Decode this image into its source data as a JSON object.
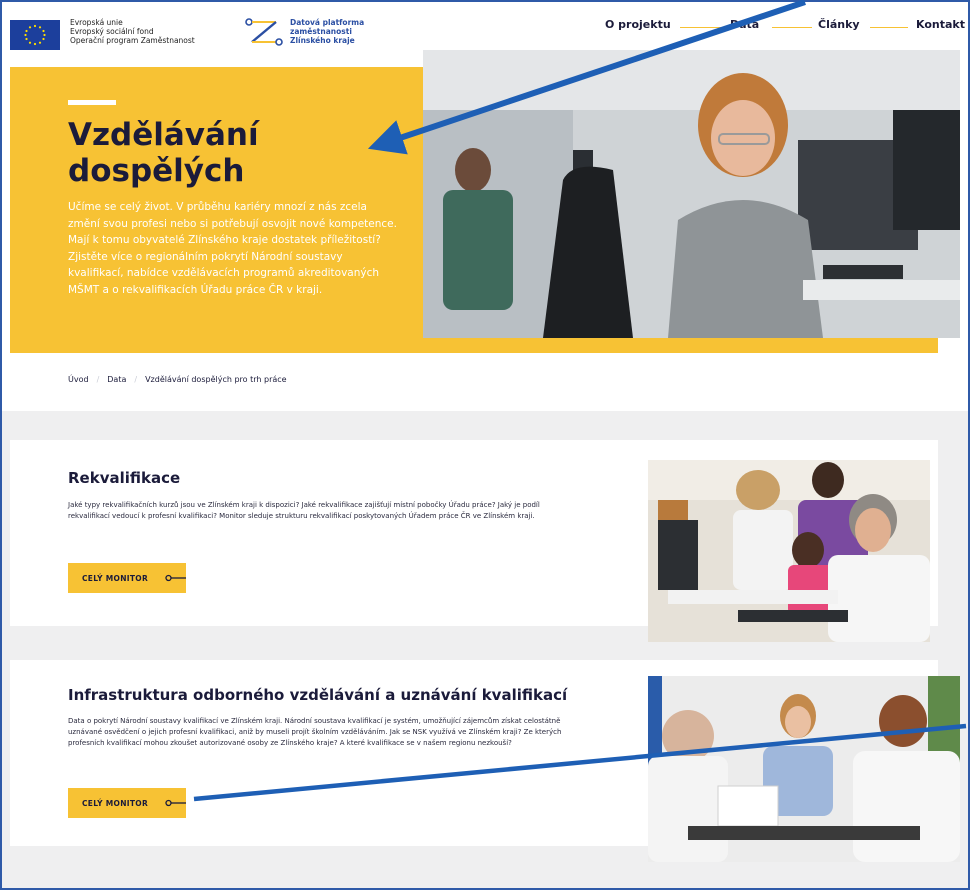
{
  "header": {
    "eu_lines": [
      "Evropská unie",
      "Evropský sociální fond",
      "Operační program Zaměstnanost"
    ],
    "platform_lines": [
      "Datová platforma",
      "zaměstnanosti",
      "Zlínského kraje"
    ],
    "nav": [
      {
        "label": "O projektu"
      },
      {
        "label": "Data"
      },
      {
        "label": "Články"
      },
      {
        "label": "Kontakt"
      }
    ]
  },
  "hero": {
    "title_line1": "Vzdělávání",
    "title_line2": "dospělých",
    "text": "Učíme se celý život. V průběhu kariéry mnozí z nás zcela změní svou profesi nebo si potřebují osvojit nové kompetence. Mají k tomu obyvatelé Zlínského kraje dostatek příležitostí? Zjistěte více o regionálním pokrytí Národní soustavy kvalifikací, nabídce vzdělávacích programů akreditovaných MŠMT a o rekvalifikacích Úřadu práce ČR v kraji."
  },
  "breadcrumb": [
    "Úvod",
    "Data",
    "Vzdělávání dospělých pro trh práce"
  ],
  "cards": [
    {
      "title": "Rekvalifikace",
      "text": "Jaké typy rekvalifikačních kurzů jsou ve Zlínském kraji k dispozici? Jaké rekvalifikace zajišťují místní pobočky Úřadu práce? Jaký je podíl rekvalifikací vedoucí k profesní kvalifikaci? Monitor sleduje strukturu rekvalifikací poskytovaných Úřadem práce ČR ve Zlínském kraji.",
      "cta": "CELÝ MONITOR"
    },
    {
      "title": "Infrastruktura odborného vzdělávání a uznávání kvalifikací",
      "text": "Data o pokrytí Národní soustavy kvalifikací ve Zlínském kraji. Národní soustava kvalifikací je systém, umožňující zájemcům získat celostátně uznávané osvědčení o jejich profesní kvalifikaci, aniž by museli projít školním vzděláváním. Jak se NSK využívá ve Zlínském kraji? Ze kterých profesních kvalifikací mohou zkoušet autorizované osoby ze Zlínského kraje? A které kvalifikace se v našem regionu nezkouší?",
      "cta": "CELÝ MONITOR"
    }
  ],
  "colors": {
    "accent_yellow": "#f7c234",
    "navy": "#1b1b3a",
    "annotation_blue": "#1e5fb5",
    "eu_blue": "#1c3f9c"
  }
}
